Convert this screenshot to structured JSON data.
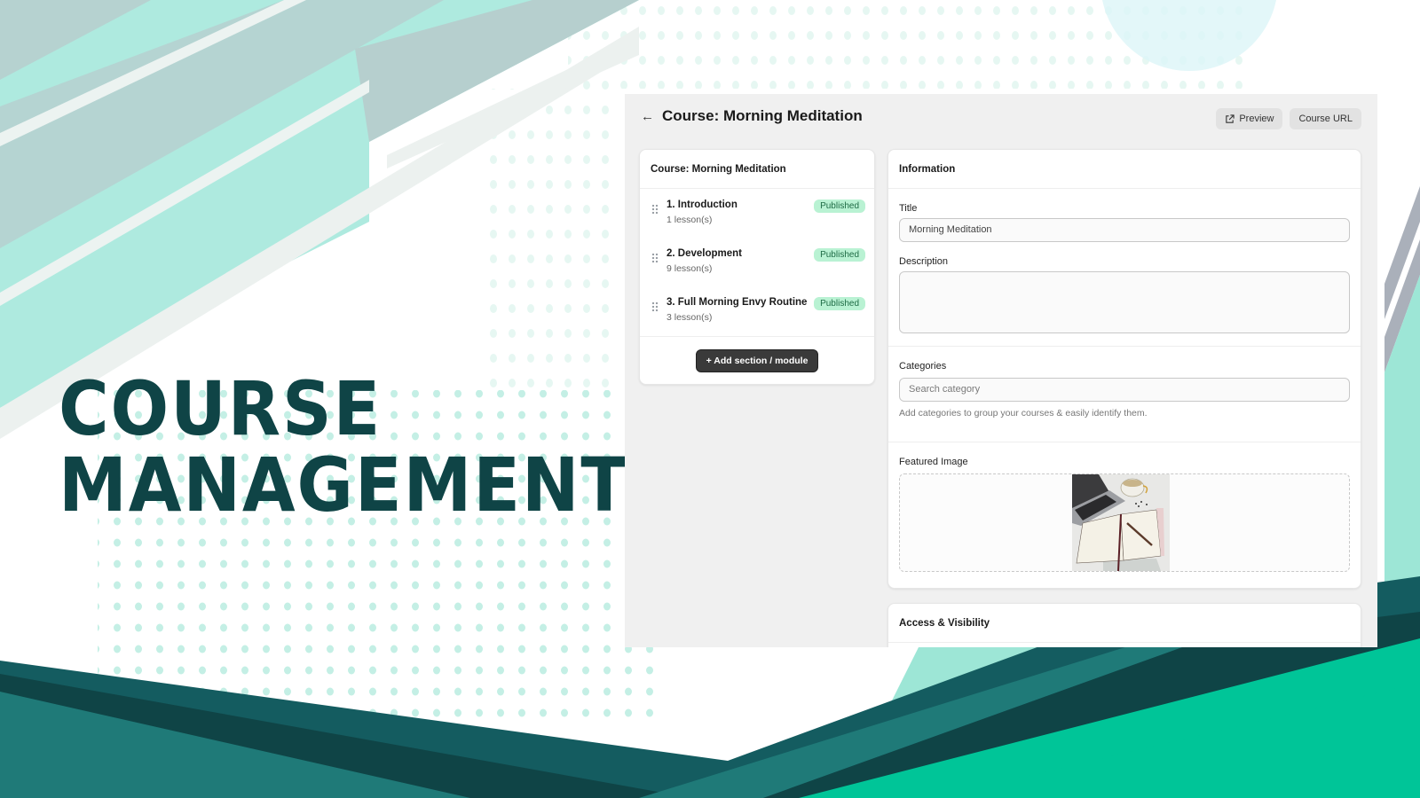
{
  "hero": {
    "line1": "COURSE",
    "line2": "MANAGEMENT"
  },
  "colors": {
    "hero_text": "#0f4446",
    "mint": "#aeeadf",
    "teal_dark": "#0f4446",
    "teal_mid": "#1f7a78",
    "green_bright": "#00c598",
    "badge_bg": "#b9f2d3"
  },
  "header": {
    "back_icon": "arrow-left-icon",
    "title": "Course: Morning Meditation",
    "preview_label": "Preview",
    "preview_icon": "external-link-icon",
    "course_url_label": "Course URL"
  },
  "outline": {
    "title": "Course: Morning Meditation",
    "modules": [
      {
        "name": "1. Introduction",
        "lessons": "1 lesson(s)",
        "status": "Published"
      },
      {
        "name": "2. Development",
        "lessons": "9 lesson(s)",
        "status": "Published"
      },
      {
        "name": "3. Full Morning Envy Routine",
        "lessons": "3 lesson(s)",
        "status": "Published"
      }
    ],
    "add_button": "+  Add section / module"
  },
  "information": {
    "title": "Information",
    "title_label": "Title",
    "title_value": "Morning Meditation",
    "description_label": "Description",
    "description_value": "",
    "categories_label": "Categories",
    "categories_placeholder": "Search category",
    "categories_help": "Add categories to group your courses & easily identify them.",
    "featured_image_label": "Featured Image"
  },
  "access": {
    "title": "Access & Visibility"
  }
}
